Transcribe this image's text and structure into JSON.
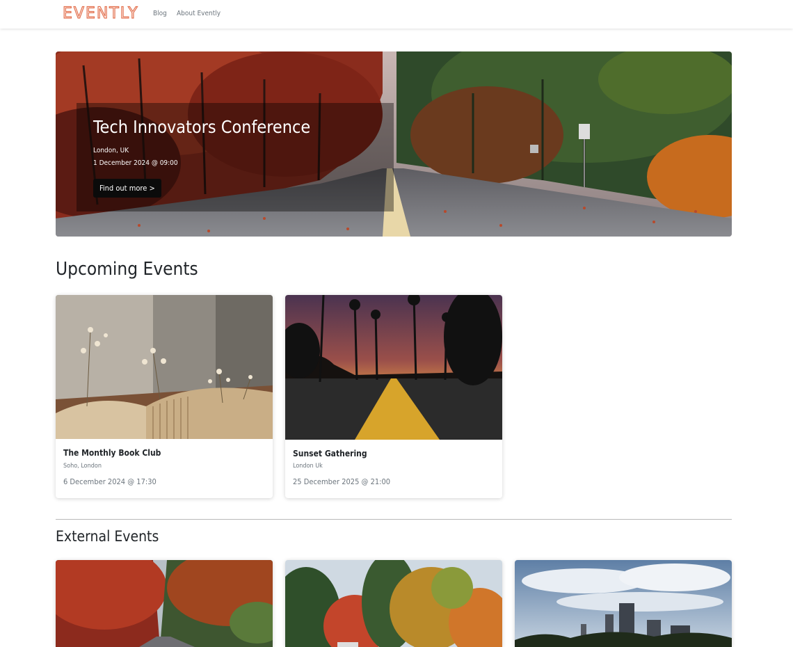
{
  "nav": {
    "brand": "EVENTLY",
    "links": [
      {
        "label": "Blog"
      },
      {
        "label": "About Evently"
      }
    ],
    "brand_color": "#e3714f"
  },
  "hero": {
    "title": "Tech Innovators Conference",
    "location": "London, UK",
    "datetime": "1 December 2024 @ 09:00",
    "button_label": "Find out more >"
  },
  "upcoming": {
    "heading": "Upcoming Events",
    "events": [
      {
        "title": "The Monthly Book Club",
        "location": "Soho, London",
        "datetime": "6 December 2024 @ 17:30",
        "image": "open book with dried flowers"
      },
      {
        "title": "Sunset Gathering",
        "location": "London Uk",
        "datetime": "25 December 2025 @ 21:00",
        "image": "palm trees at sunset over road"
      }
    ]
  },
  "external": {
    "heading": "External Events",
    "events": [
      {
        "image": "autumn road with red trees"
      },
      {
        "image": "autumn park trees"
      },
      {
        "image": "city skyline with clouds"
      }
    ]
  }
}
